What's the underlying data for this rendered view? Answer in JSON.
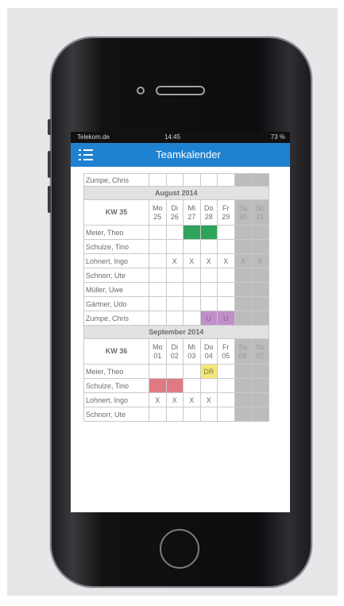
{
  "status": {
    "carrier": "Telekom.de",
    "time": "14:45",
    "battery": "73 %"
  },
  "app": {
    "title": "Teamkalender"
  },
  "calendar": {
    "top_partial_row": {
      "name": "Zumpe, Chris"
    },
    "august": {
      "month": "August 2014",
      "kw": "KW 35",
      "days": [
        {
          "d": "Mo",
          "n": "25"
        },
        {
          "d": "Di",
          "n": "26"
        },
        {
          "d": "Mi",
          "n": "27"
        },
        {
          "d": "Do",
          "n": "28"
        },
        {
          "d": "Fr",
          "n": "29"
        },
        {
          "d": "Sa",
          "n": "30"
        },
        {
          "d": "So",
          "n": "31"
        }
      ],
      "rows": [
        {
          "name": "Meier, Theo",
          "cells": [
            "",
            "",
            "",
            "",
            "",
            "",
            ""
          ]
        },
        {
          "name": "Schulze, Tino",
          "cells": [
            "",
            "",
            "",
            "",
            "",
            "",
            ""
          ]
        },
        {
          "name": "Lohnert, Ingo",
          "cells": [
            "",
            "X",
            "X",
            "X",
            "X",
            "X",
            "X"
          ]
        },
        {
          "name": "Schnorr, Ute",
          "cells": [
            "",
            "",
            "",
            "",
            "",
            "",
            ""
          ]
        },
        {
          "name": "Müller, Uwe",
          "cells": [
            "",
            "",
            "",
            "",
            "",
            "",
            ""
          ]
        },
        {
          "name": "Gärtner, Udo",
          "cells": [
            "",
            "",
            "",
            "",
            "",
            "",
            ""
          ]
        },
        {
          "name": "Zumpe, Chris",
          "cells": [
            "",
            "",
            "",
            "U",
            "U",
            "",
            ""
          ]
        }
      ]
    },
    "september": {
      "month": "September 2014",
      "kw": "KW 36",
      "days": [
        {
          "d": "Mo",
          "n": "01"
        },
        {
          "d": "Di",
          "n": "02"
        },
        {
          "d": "Mi",
          "n": "03"
        },
        {
          "d": "Do",
          "n": "04"
        },
        {
          "d": "Fr",
          "n": "05"
        },
        {
          "d": "Sa",
          "n": "06"
        },
        {
          "d": "So",
          "n": "07"
        }
      ],
      "rows": [
        {
          "name": "Meier, Theo",
          "cells": [
            "",
            "",
            "",
            "DR",
            "",
            "",
            ""
          ]
        },
        {
          "name": "Schulze, Tino",
          "cells": [
            "",
            "",
            "",
            "",
            "",
            "",
            ""
          ]
        },
        {
          "name": "Lohnert, Ingo",
          "cells": [
            "X",
            "X",
            "X",
            "X",
            "",
            "",
            ""
          ]
        },
        {
          "name": "Schnorr, Ute",
          "cells": [
            "",
            "",
            "",
            "",
            "",
            "",
            ""
          ]
        }
      ]
    },
    "colors": {
      "green": "#2ea35b",
      "purple": "#c08ec9",
      "yellow": "#f4e87a",
      "red": "#e07a82",
      "nav": "#1f82d1"
    }
  }
}
